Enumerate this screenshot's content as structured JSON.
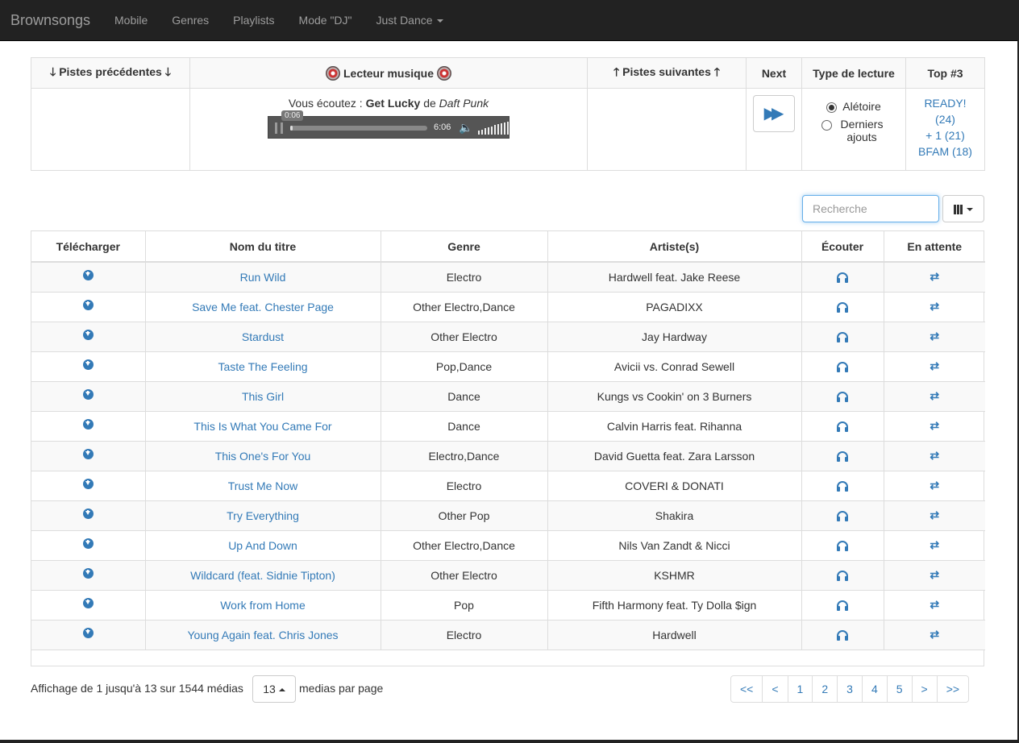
{
  "navbar": {
    "brand": "Brownsongs",
    "items": [
      {
        "label": "Mobile"
      },
      {
        "label": "Genres"
      },
      {
        "label": "Playlists"
      },
      {
        "label": "Mode \"DJ\""
      },
      {
        "label": "Just Dance"
      }
    ]
  },
  "player": {
    "headers": {
      "previous": "Pistes précédentes",
      "player": "Lecteur musique",
      "next_tracks": "Pistes suivantes",
      "next": "Next",
      "play_type": "Type de lecture",
      "top": "Top #3"
    },
    "now_playing_prefix": "Vous écoutez :",
    "title": "Get Lucky",
    "by": "de",
    "artist": "Daft Punk",
    "current_time": "0:06",
    "duration": "6:06",
    "progress": 0.02,
    "play_types": [
      {
        "label": "Alétoire",
        "selected": true
      },
      {
        "label": "Derniers ajouts",
        "selected": false
      }
    ],
    "top": [
      {
        "label": "READY!"
      },
      {
        "label": "(24)"
      },
      {
        "label": "+ 1 (21)"
      },
      {
        "label": "BFAM (18)"
      }
    ]
  },
  "search": {
    "placeholder": "Recherche"
  },
  "table": {
    "columns": [
      "Télécharger",
      "Nom du titre",
      "Genre",
      "Artiste(s)",
      "Écouter",
      "En attente"
    ],
    "rows": [
      {
        "title": "Run Wild",
        "genre": "Electro",
        "artist": "Hardwell feat. Jake Reese"
      },
      {
        "title": "Save Me feat. Chester Page",
        "genre": "Other Electro,Dance",
        "artist": "PAGADIXX"
      },
      {
        "title": "Stardust",
        "genre": "Other Electro",
        "artist": "Jay Hardway"
      },
      {
        "title": "Taste The Feeling",
        "genre": "Pop,Dance",
        "artist": "Avicii vs. Conrad Sewell"
      },
      {
        "title": "This Girl",
        "genre": "Dance",
        "artist": "Kungs vs Cookin' on 3 Burners"
      },
      {
        "title": "This Is What You Came For",
        "genre": "Dance",
        "artist": "Calvin Harris feat. Rihanna"
      },
      {
        "title": "This One's For You",
        "genre": "Electro,Dance",
        "artist": "David Guetta feat. Zara Larsson"
      },
      {
        "title": "Trust Me Now",
        "genre": "Electro",
        "artist": "COVERI & DONATI"
      },
      {
        "title": "Try Everything",
        "genre": "Other Pop",
        "artist": "Shakira"
      },
      {
        "title": "Up And Down",
        "genre": "Other Electro,Dance",
        "artist": "Nils Van Zandt & Nicci"
      },
      {
        "title": "Wildcard (feat. Sidnie Tipton)",
        "genre": "Other Electro",
        "artist": "KSHMR"
      },
      {
        "title": "Work from Home",
        "genre": "Pop",
        "artist": "Fifth Harmony feat. Ty Dolla $ign"
      },
      {
        "title": "Young Again feat. Chris Jones",
        "genre": "Electro",
        "artist": "Hardwell"
      }
    ]
  },
  "footer": {
    "info": "Affichage de 1 jusqu'à 13 sur 1544 médias",
    "per_page_value": "13",
    "per_page_label": "medias par page",
    "pages": [
      "<<",
      "<",
      "1",
      "2",
      "3",
      "4",
      "5",
      ">",
      ">>"
    ]
  },
  "colors": {
    "accent": "#337ab7",
    "navbar": "#222222"
  }
}
